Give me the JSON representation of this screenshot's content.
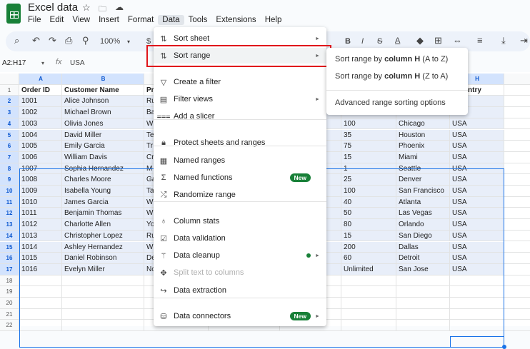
{
  "app": {
    "title": "Excel data",
    "brand_color": "#188038",
    "icons": [
      "star-icon",
      "move-to-folder-icon",
      "cloud-saved-icon"
    ]
  },
  "menubar": [
    "File",
    "Edit",
    "View",
    "Insert",
    "Format",
    "Data",
    "Tools",
    "Extensions",
    "Help"
  ],
  "toolbar": {
    "zoom": "100%",
    "currency": "$"
  },
  "formula": {
    "name_box": "A2:H17",
    "fx": "fx",
    "value": "USA"
  },
  "columns": [
    "A",
    "B",
    "",
    "",
    "",
    "",
    "",
    "H"
  ],
  "headers": {
    "A": "Order ID",
    "B": "Customer Name",
    "C": "Pr",
    "H": "ntry"
  },
  "rows": [
    {
      "n": "2",
      "a": "1001",
      "b": "Alice Johnson",
      "c": "Ru",
      "f": "",
      "g": "",
      "h": ""
    },
    {
      "n": "3",
      "a": "1002",
      "b": "Michael Brown",
      "c": "Ba",
      "f": "",
      "g": "",
      "h": ""
    },
    {
      "n": "4",
      "a": "1003",
      "b": "Olivia Jones",
      "c": "W",
      "f": "100",
      "g": "Chicago",
      "h": "USA"
    },
    {
      "n": "5",
      "a": "1004",
      "b": "David Miller",
      "c": "Te",
      "f": "35",
      "g": "Houston",
      "h": "USA"
    },
    {
      "n": "6",
      "a": "1005",
      "b": "Emily Garcia",
      "c": "Tr",
      "f": "75",
      "g": "Phoenix",
      "h": "USA"
    },
    {
      "n": "7",
      "a": "1006",
      "b": "William Davis",
      "c": "Cr",
      "f": "15",
      "g": "Miami",
      "h": "USA"
    },
    {
      "n": "8",
      "a": "1007",
      "b": "Sophia Hernandez",
      "c": "M",
      "f": "1",
      "g": "Seattle",
      "h": "USA"
    },
    {
      "n": "9",
      "a": "1008",
      "b": "Charles Moore",
      "c": "Ga",
      "f": "25",
      "g": "Denver",
      "h": "USA"
    },
    {
      "n": "10",
      "a": "1009",
      "b": "Isabella Young",
      "c": "Ta",
      "f": "100",
      "g": "San Francisco",
      "h": "USA"
    },
    {
      "n": "11",
      "a": "1010",
      "b": "James Garcia",
      "c": "W",
      "f": "40",
      "g": "Atlanta",
      "h": "USA"
    },
    {
      "n": "12",
      "a": "1011",
      "b": "Benjamin Thomas",
      "c": "W",
      "f": "50",
      "g": "Las Vegas",
      "h": "USA"
    },
    {
      "n": "13",
      "a": "1012",
      "b": "Charlotte Allen",
      "c": "Yo",
      "f": "80",
      "g": "Orlando",
      "h": "USA"
    },
    {
      "n": "14",
      "a": "1013",
      "b": "Christopher Lopez",
      "c": "Ru",
      "f": "15",
      "g": "San Diego",
      "h": "USA"
    },
    {
      "n": "15",
      "a": "1014",
      "b": "Ashley Hernandez",
      "c": "W",
      "f": "200",
      "g": "Dallas",
      "h": "USA"
    },
    {
      "n": "16",
      "a": "1015",
      "b": "Daniel Robinson",
      "c": "De",
      "f": "60",
      "g": "Detroit",
      "h": "USA"
    },
    {
      "n": "17",
      "a": "1016",
      "b": "Evelyn Miller",
      "c": "No",
      "f": "Unlimited",
      "g": "San Jose",
      "h": "USA"
    }
  ],
  "empty_rows": [
    "18",
    "19",
    "20",
    "21",
    "22"
  ],
  "data_menu": {
    "items": [
      {
        "label": "Sort sheet",
        "icon": "sort-icon",
        "arrow": true
      },
      {
        "label": "Sort range",
        "icon": "sort-icon",
        "arrow": true,
        "highlighted": true
      },
      {
        "label": "Create a filter",
        "icon": "filter-icon"
      },
      {
        "label": "Filter views",
        "icon": "filter-views-icon",
        "arrow": true
      },
      {
        "label": "Add a slicer",
        "icon": "slicer-icon"
      },
      {
        "label": "Protect sheets and ranges",
        "icon": "lock-icon"
      },
      {
        "label": "Named ranges",
        "icon": "named-ranges-icon"
      },
      {
        "label": "Named functions",
        "icon": "sigma-icon",
        "badge": "New"
      },
      {
        "label": "Randomize range",
        "icon": "shuffle-icon"
      },
      {
        "label": "Column stats",
        "icon": "lightbulb-icon"
      },
      {
        "label": "Data validation",
        "icon": "data-validation-icon"
      },
      {
        "label": "Data cleanup",
        "icon": "magic-wand-icon",
        "arrow": true,
        "dot": true
      },
      {
        "label": "Split text to columns",
        "icon": "split-icon",
        "disabled": true
      },
      {
        "label": "Data extraction",
        "icon": "extraction-icon"
      },
      {
        "label": "Data connectors",
        "icon": "database-icon",
        "badge": "New",
        "arrow": true
      }
    ]
  },
  "sort_submenu": {
    "items": [
      {
        "pre": "Sort range by ",
        "bold": "column H",
        "post": " (A to Z)"
      },
      {
        "pre": "Sort range by ",
        "bold": "column H",
        "post": " (Z to A)"
      },
      {
        "pre": "Advanced range sorting options",
        "bold": "",
        "post": ""
      }
    ]
  },
  "highlight_color": "#e0161b"
}
